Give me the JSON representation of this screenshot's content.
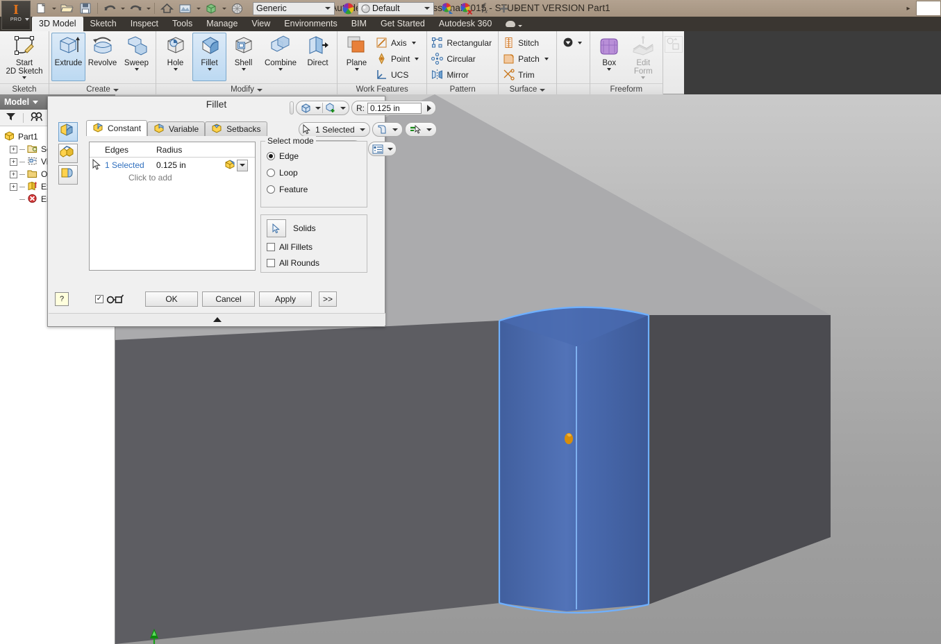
{
  "window": {
    "title": "Autodesk Inventor Professional 2015 - STUDENT VERSION    Part1",
    "document_name": "Part1"
  },
  "quick_access": {
    "items": [
      {
        "name": "new-icon",
        "label": "New"
      },
      {
        "name": "open-icon",
        "label": "Open"
      },
      {
        "name": "save-icon",
        "label": "Save"
      },
      {
        "name": "undo-icon",
        "label": "Undo"
      },
      {
        "name": "redo-icon",
        "label": "Redo"
      },
      {
        "name": "home-icon",
        "label": "Home View"
      },
      {
        "name": "appearance-icon",
        "label": "Appearance"
      },
      {
        "name": "material-icon",
        "label": "Material"
      },
      {
        "name": "render-icon",
        "label": "Render"
      }
    ],
    "material_combo": "Generic",
    "appearance_combo": "Default",
    "extra_icons": [
      {
        "name": "color-wheel-icon"
      },
      {
        "name": "appearance-select-icon"
      },
      {
        "name": "clear-appearance-icon"
      },
      {
        "name": "fx-parameters-icon",
        "label": "fx"
      },
      {
        "name": "add-icon"
      },
      {
        "name": "customize-caret-icon"
      }
    ]
  },
  "ribbon": {
    "tabs": [
      {
        "label": "3D Model",
        "active": true
      },
      {
        "label": "Sketch",
        "active": false
      },
      {
        "label": "Inspect",
        "active": false
      },
      {
        "label": "Tools",
        "active": false
      },
      {
        "label": "Manage",
        "active": false
      },
      {
        "label": "View",
        "active": false
      },
      {
        "label": "Environments",
        "active": false
      },
      {
        "label": "BIM",
        "active": false
      },
      {
        "label": "Get Started",
        "active": false
      },
      {
        "label": "Autodesk 360",
        "active": false
      }
    ],
    "panels": [
      {
        "label": "Sketch",
        "has_caret": false,
        "big_buttons": [
          {
            "name": "start-2d-sketch-button",
            "label": "Start",
            "label2": "2D Sketch",
            "icon": "sketch-icon",
            "caret": true,
            "selected": false,
            "width": "w2"
          }
        ],
        "small_buttons": []
      },
      {
        "label": "Create",
        "has_caret": true,
        "big_buttons": [
          {
            "name": "extrude-button",
            "label": "Extrude",
            "label2": "",
            "icon": "extrude-icon",
            "caret": false,
            "selected": true,
            "width": ""
          },
          {
            "name": "revolve-button",
            "label": "Revolve",
            "label2": "",
            "icon": "revolve-icon",
            "caret": false,
            "selected": false,
            "width": ""
          },
          {
            "name": "sweep-button",
            "label": "Sweep",
            "label2": "",
            "icon": "sweep-icon",
            "caret": true,
            "selected": false,
            "width": ""
          }
        ],
        "small_buttons": []
      },
      {
        "label": "Modify",
        "has_caret": true,
        "big_buttons": [
          {
            "name": "hole-button",
            "label": "Hole",
            "label2": "",
            "icon": "hole-icon",
            "caret": true,
            "selected": false,
            "width": ""
          },
          {
            "name": "fillet-button",
            "label": "Fillet",
            "label2": "",
            "icon": "fillet-icon",
            "caret": true,
            "selected": true,
            "width": ""
          },
          {
            "name": "shell-button",
            "label": "Shell",
            "label2": "",
            "icon": "shell-icon",
            "caret": true,
            "selected": false,
            "width": ""
          },
          {
            "name": "combine-button",
            "label": "Combine",
            "label2": "",
            "icon": "combine-icon",
            "caret": true,
            "selected": false,
            "width": "wide"
          },
          {
            "name": "direct-button",
            "label": "Direct",
            "label2": "",
            "icon": "direct-icon",
            "caret": false,
            "selected": false,
            "width": ""
          }
        ],
        "small_buttons": []
      },
      {
        "label": "Work Features",
        "has_caret": false,
        "big_buttons": [
          {
            "name": "plane-button",
            "label": "Plane",
            "label2": "",
            "icon": "plane-icon",
            "caret": true,
            "selected": false,
            "width": ""
          }
        ],
        "small_buttons": [
          {
            "name": "axis-button",
            "label": "Axis",
            "icon": "axis-icon",
            "caret": true
          },
          {
            "name": "point-button",
            "label": "Point",
            "icon": "point-icon",
            "caret": true
          },
          {
            "name": "ucs-button",
            "label": "UCS",
            "icon": "ucs-icon",
            "caret": false
          }
        ]
      },
      {
        "label": "Pattern",
        "has_caret": false,
        "big_buttons": [],
        "small_buttons": [
          {
            "name": "rectangular-pattern-button",
            "label": "Rectangular",
            "icon": "rectangular-pattern-icon",
            "caret": false
          },
          {
            "name": "circular-pattern-button",
            "label": "Circular",
            "icon": "circular-pattern-icon",
            "caret": false
          },
          {
            "name": "mirror-button",
            "label": "Mirror",
            "icon": "mirror-icon",
            "caret": false
          }
        ]
      },
      {
        "label": "Surface",
        "has_caret": true,
        "big_buttons": [],
        "small_buttons": [
          {
            "name": "stitch-button",
            "label": "Stitch",
            "icon": "stitch-icon",
            "caret": false
          },
          {
            "name": "patch-button",
            "label": "Patch",
            "icon": "patch-icon",
            "caret": true
          },
          {
            "name": "trim-button",
            "label": "Trim",
            "icon": "trim-icon",
            "caret": false
          }
        ]
      },
      {
        "label": "",
        "has_caret": false,
        "big_buttons": [],
        "small_buttons": [
          {
            "name": "thicken-offset-button",
            "label": "",
            "icon": "thicken-icon",
            "caret": true
          }
        ]
      },
      {
        "label": "Freeform",
        "has_caret": false,
        "big_buttons": [
          {
            "name": "box-button",
            "label": "Box",
            "label2": "",
            "icon": "freeform-box-icon",
            "caret": true,
            "selected": false,
            "width": ""
          },
          {
            "name": "edit-form-button",
            "label": "Edit",
            "label2": "Form",
            "icon": "edit-form-icon",
            "caret": true,
            "selected": false,
            "width": "",
            "disabled": true
          }
        ],
        "small_buttons": []
      }
    ]
  },
  "browser": {
    "header": "Model",
    "tools": [
      {
        "name": "filter-icon",
        "label": "Filter"
      },
      {
        "name": "find-icon",
        "label": "Find"
      }
    ],
    "tree": [
      {
        "label": "Part1",
        "icon": "part-icon",
        "expandable": false,
        "depth": 0
      },
      {
        "label": "Solid",
        "icon": "solid-bodies-icon",
        "expandable": true,
        "depth": 1
      },
      {
        "label": "View",
        "icon": "view-icon",
        "expandable": true,
        "depth": 1
      },
      {
        "label": "Origi",
        "icon": "origin-folder-icon",
        "expandable": true,
        "depth": 1
      },
      {
        "label": "Extr",
        "icon": "extrusion-icon",
        "expandable": true,
        "depth": 1
      },
      {
        "label": "End",
        "icon": "end-of-part-icon",
        "expandable": false,
        "depth": 1
      }
    ]
  },
  "dialog": {
    "title": "Fillet",
    "radius_field": {
      "label": "R:",
      "value": "0.125 in"
    },
    "selection_status": "1 Selected",
    "tabs": [
      {
        "label": "Constant",
        "active": true,
        "icon": "constant-fillet-icon"
      },
      {
        "label": "Variable",
        "active": false,
        "icon": "variable-fillet-icon"
      },
      {
        "label": "Setbacks",
        "active": false,
        "icon": "setbacks-fillet-icon"
      }
    ],
    "mode_buttons": [
      {
        "name": "edge-fillet-mode",
        "active": true,
        "icon": "edge-fillet-icon"
      },
      {
        "name": "face-fillet-mode",
        "active": false,
        "icon": "face-fillet-icon"
      },
      {
        "name": "full-round-fillet-mode",
        "active": false,
        "icon": "full-round-fillet-icon"
      }
    ],
    "edges_table": {
      "columns": [
        "Edges",
        "Radius"
      ],
      "rows": [
        {
          "edges": "1 Selected",
          "radius": "0.125 in"
        }
      ],
      "add_hint": "Click to add"
    },
    "select_mode": {
      "legend": "Select mode",
      "options": [
        {
          "label": "Edge",
          "selected": true
        },
        {
          "label": "Loop",
          "selected": false
        },
        {
          "label": "Feature",
          "selected": false
        }
      ]
    },
    "solids": {
      "label": "Solids",
      "checkboxes": [
        {
          "label": "All Fillets",
          "checked": false
        },
        {
          "label": "All Rounds",
          "checked": false
        }
      ]
    },
    "footer": {
      "help_label": "?",
      "preview_checked": true,
      "buttons": [
        {
          "name": "ok-button",
          "label": "OK"
        },
        {
          "name": "cancel-button",
          "label": "Cancel"
        },
        {
          "name": "apply-button",
          "label": "Apply"
        },
        {
          "name": "expand-button",
          "label": ">>"
        }
      ]
    },
    "floating_toolbar": [
      {
        "name": "accept-selection-button",
        "glyph": "✓",
        "color": "#1f7a1f"
      },
      {
        "name": "add-selection-button",
        "glyph": "✚",
        "color": "#128a12"
      },
      {
        "name": "remove-selection-button",
        "glyph": "✕",
        "color": "#b52020"
      }
    ]
  },
  "viewport": {
    "model_name": "Part1",
    "highlight_color": "#4a6fb5",
    "highlight_edge_color": "#5ea2ff",
    "top_face_color": "#a9a9ab",
    "left_face_color": "#5e5e63",
    "right_face_color": "#4a4a4f",
    "axis_indicator": {
      "name": "origin-axis-indicator",
      "color": "#19a319"
    },
    "fillet_grip": {
      "name": "fillet-radius-grip",
      "color": "#d48806"
    }
  },
  "colors": {
    "title_bar": "#ab9a87",
    "tab_strip": "#3a3631",
    "ribbon_bg": "#f0f0f0",
    "accent_orange": "#e8751a",
    "selection_blue": "#2f6fbe"
  }
}
